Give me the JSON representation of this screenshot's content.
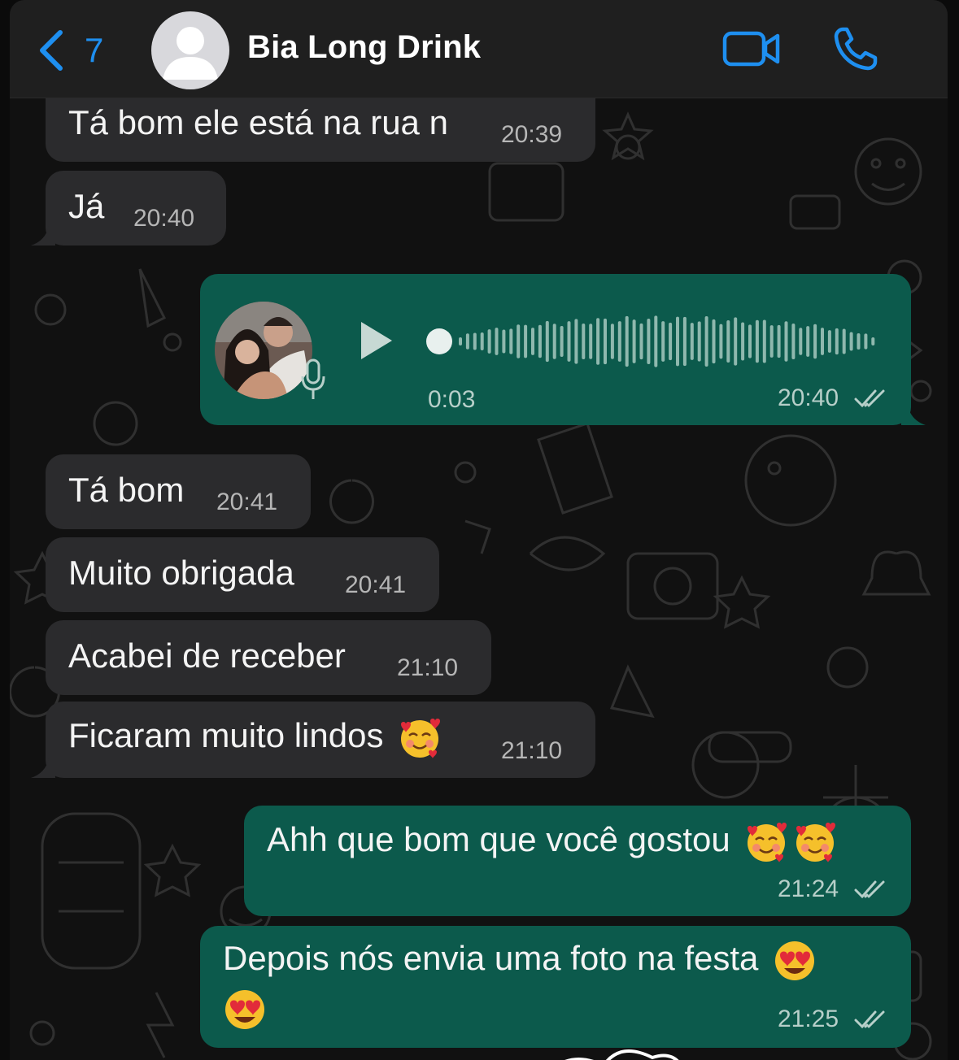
{
  "header": {
    "back_count": "7",
    "contact_name": "Bia Long Drink",
    "icons": {
      "back": "chevron-left-icon",
      "avatar": "person-placeholder-icon",
      "video": "video-camera-icon",
      "call": "phone-icon"
    },
    "accent_color": "#1e8ff0"
  },
  "messages": [
    {
      "direction": "in",
      "text": "Tá bom ele está na rua n",
      "time": "20:39"
    },
    {
      "direction": "in",
      "text": "Já",
      "time": "20:40"
    },
    {
      "direction": "out",
      "type": "voice",
      "duration": "0:03",
      "time": "20:40",
      "status": "read-ticks"
    },
    {
      "direction": "in",
      "text": "Tá bom",
      "time": "20:41"
    },
    {
      "direction": "in",
      "text": "Muito obrigada",
      "time": "20:41"
    },
    {
      "direction": "in",
      "text": "Acabei de receber",
      "time": "21:10"
    },
    {
      "direction": "in",
      "text": "Ficaram muito lindos",
      "emoji": [
        "smiling-face-with-hearts"
      ],
      "time": "21:10"
    },
    {
      "direction": "out",
      "text": "Ahh que bom que você gostou",
      "emoji": [
        "smiling-face-with-hearts",
        "smiling-face-with-hearts"
      ],
      "time": "21:24",
      "status": "read-ticks"
    },
    {
      "direction": "out",
      "text": "Depois nós envia uma foto na festa",
      "emoji": [
        "heart-eyes",
        "heart-eyes"
      ],
      "time": "21:25",
      "status": "read-ticks"
    }
  ],
  "colors": {
    "incoming_bubble": "#2b2b2d",
    "outgoing_bubble": "#0c5a4c",
    "background": "#111111"
  }
}
